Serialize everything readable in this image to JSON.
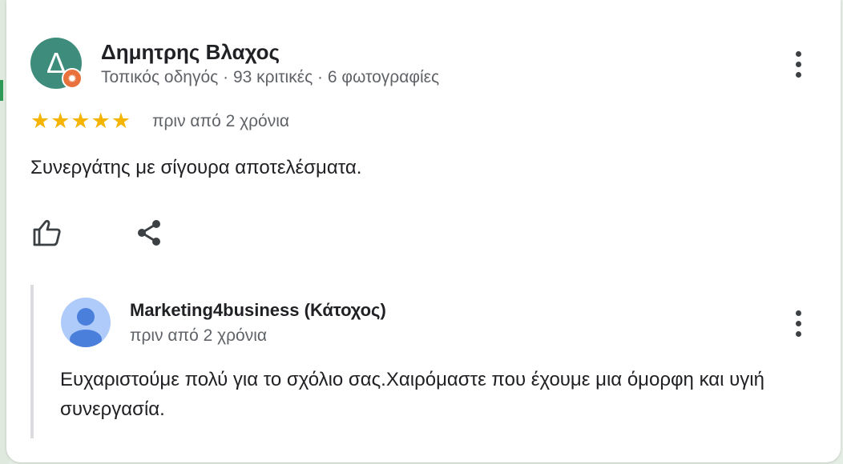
{
  "review": {
    "avatar_letter": "Δ",
    "avatar_color": "#3e8d7c",
    "badge_icon": "local-guide-star-icon",
    "badge_symbol": "✹",
    "author_name": "Δημητρης Βλαχος",
    "author_meta": "Τοπικός οδηγός · 93 κριτικές · 6 φωτογραφίες",
    "rating": 5,
    "rating_max": 5,
    "stars_display": "★★★★★",
    "time": "πριν από 2 χρόνια",
    "text": "Συνεργάτης με σίγουρα αποτελέσματα.",
    "actions": [
      {
        "icon": "thumbs-up-icon"
      },
      {
        "icon": "share-icon"
      }
    ],
    "more_icon": "more-vert-icon"
  },
  "owner_reply": {
    "author_name": "Marketing4business (Κάτοχος)",
    "time": "πριν από 2 χρόνια",
    "text": "Ευχαριστούμε πολύ για το σχόλιο σας.Χαιρόμαστε που έχουμε μια όμορφη και υγιή συνεργασία.",
    "avatar_icon": "default-person-avatar-icon",
    "more_icon": "more-vert-icon"
  },
  "colors": {
    "star": "#f4b400",
    "badge": "#e8713c",
    "owner_avatar_bg": "#aecbfa",
    "owner_avatar_fg": "#4a7fdb"
  }
}
